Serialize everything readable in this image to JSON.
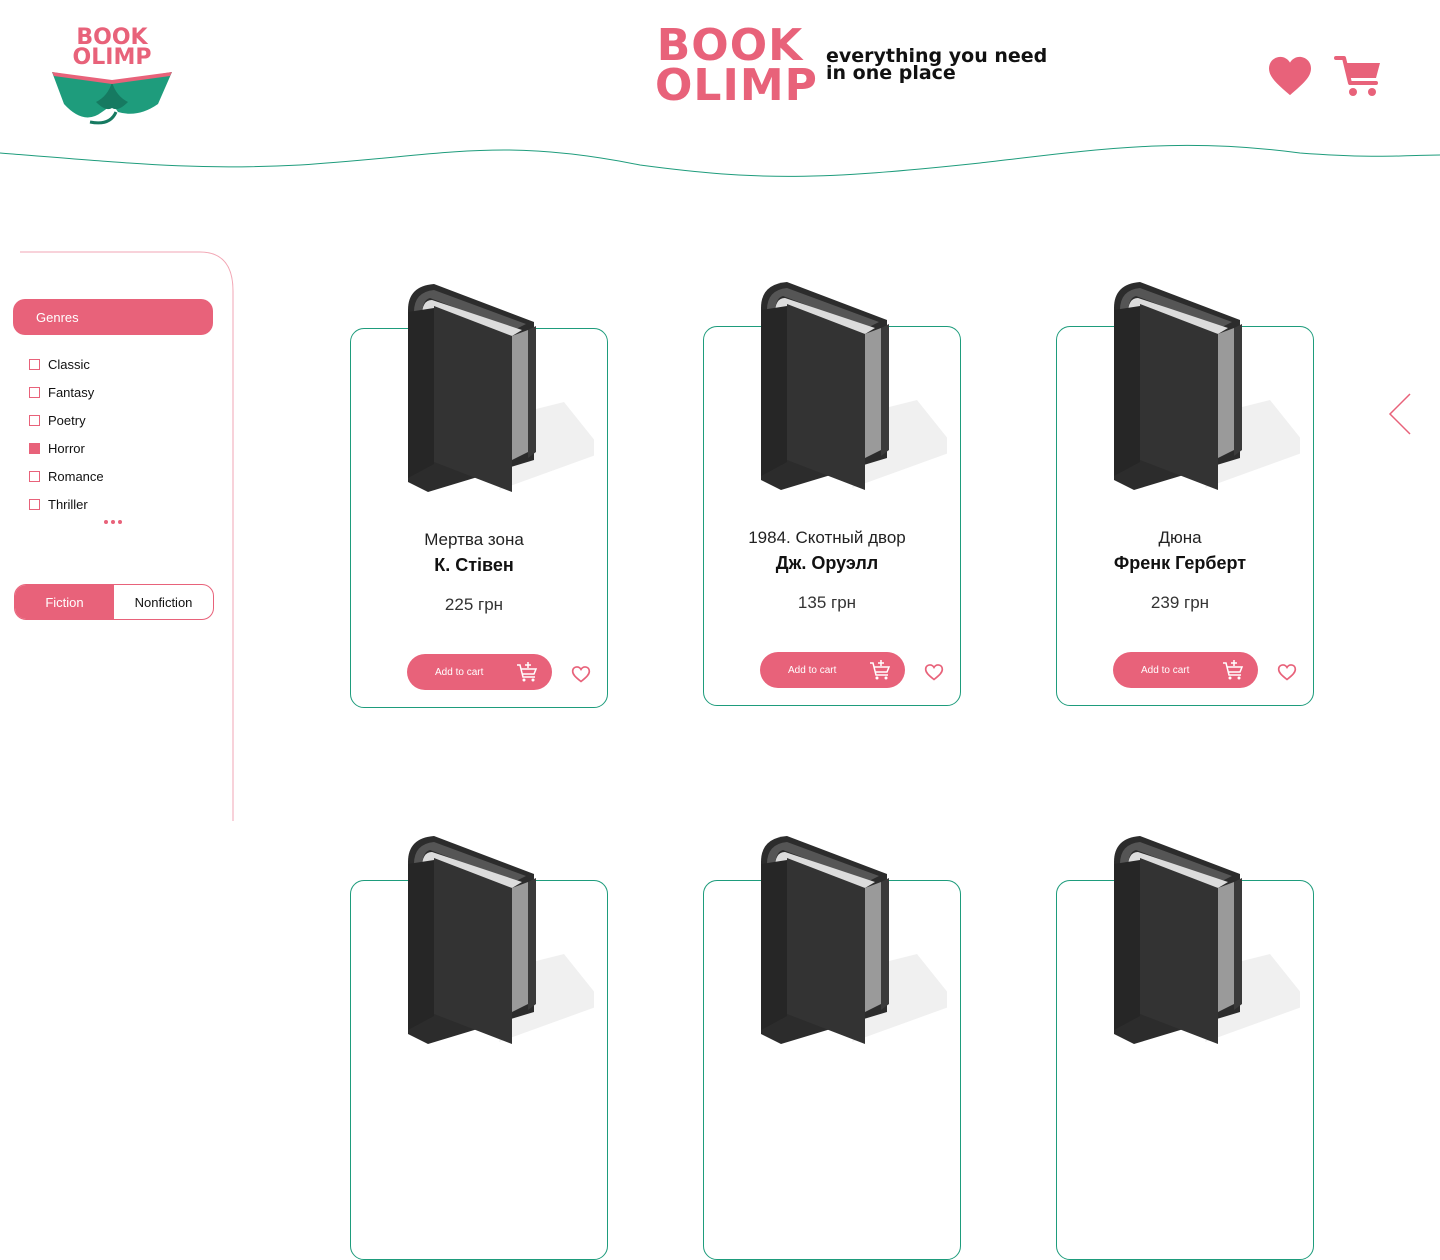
{
  "brand": {
    "logo_line1": "BOOK",
    "logo_line2": "OLIMP",
    "name_line1": "BOOK",
    "name_line2": "OLIMP",
    "tagline_line1": "everything you need",
    "tagline_line2": "in one place"
  },
  "header": {
    "favorites_icon": "heart-icon",
    "cart_icon": "cart-icon"
  },
  "sidebar": {
    "genres_label": "Genres",
    "genres": [
      {
        "label": "Classic",
        "checked": false
      },
      {
        "label": "Fantasy",
        "checked": false
      },
      {
        "label": "Poetry",
        "checked": false
      },
      {
        "label": "Horror",
        "checked": true
      },
      {
        "label": "Romance",
        "checked": false
      },
      {
        "label": "Thriller",
        "checked": false
      }
    ],
    "more_icon": "more-dots-icon",
    "tabs": [
      {
        "label": "Fiction",
        "active": true
      },
      {
        "label": "Nonfiction",
        "active": false
      }
    ]
  },
  "products": [
    {
      "title": "Мертва зона",
      "author": "К. Стівен",
      "price": "225 грн",
      "cta": "Add to cart"
    },
    {
      "title": "1984. Скотный двор",
      "author": "Дж. Оруэлл",
      "price": "135 грн",
      "cta": "Add to cart"
    },
    {
      "title": "Дюна",
      "author": "Френк Герберт",
      "price": "239 грн",
      "cta": "Add to cart"
    }
  ],
  "colors": {
    "accent": "#e8627a",
    "border": "#1e9c7c",
    "logo_green": "#1e9c7c",
    "book_dark": "#2f2f2f"
  }
}
